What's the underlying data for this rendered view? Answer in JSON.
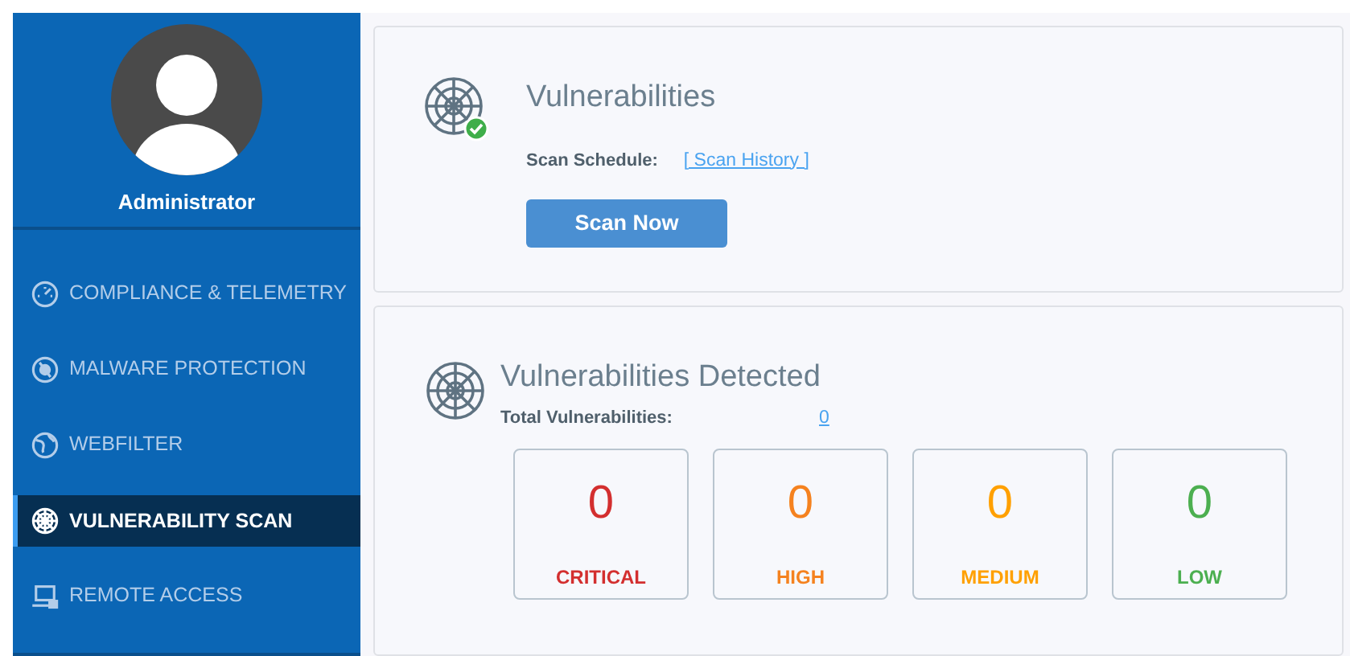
{
  "sidebar": {
    "user": "Administrator",
    "items": [
      {
        "label": "COMPLIANCE & TELEMETRY",
        "selected": false
      },
      {
        "label": "MALWARE PROTECTION",
        "selected": false
      },
      {
        "label": "WEBFILTER",
        "selected": false
      },
      {
        "label": "VULNERABILITY SCAN",
        "selected": true
      },
      {
        "label": "REMOTE ACCESS",
        "selected": false
      }
    ]
  },
  "scan_card": {
    "title": "Vulnerabilities",
    "schedule_label": "Scan Schedule:",
    "history_link": "[ Scan History ]",
    "button": "Scan Now"
  },
  "detected_card": {
    "title": "Vulnerabilities Detected",
    "total_label": "Total Vulnerabilities:",
    "total_value": "0",
    "severities": [
      {
        "count": "0",
        "label": "CRITICAL",
        "color": "#d32f2f"
      },
      {
        "count": "0",
        "label": "HIGH",
        "color": "#f5821f"
      },
      {
        "count": "0",
        "label": "MEDIUM",
        "color": "#ffa000"
      },
      {
        "count": "0",
        "label": "LOW",
        "color": "#4caf50"
      }
    ]
  }
}
